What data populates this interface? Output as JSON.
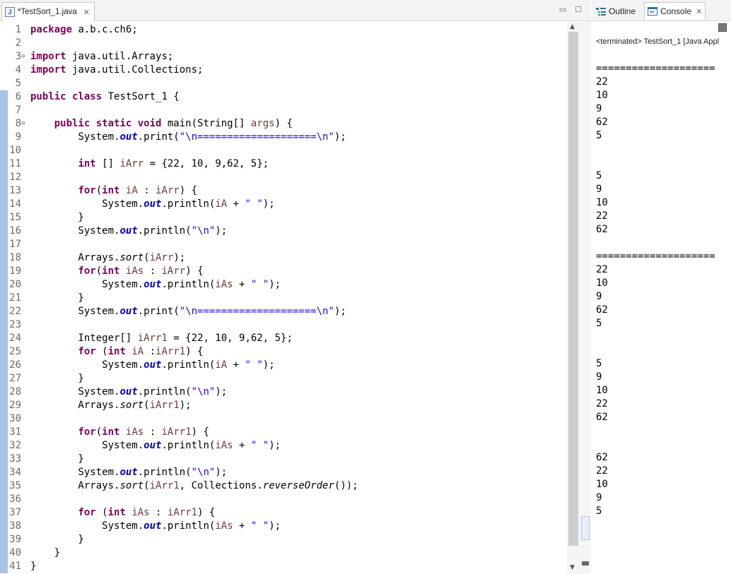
{
  "editor": {
    "tab_label": "*TestSort_1.java",
    "tab_icon": "J",
    "minimize_glyph": "▭",
    "maximize_glyph": "☐",
    "close_glyph": "✕"
  },
  "views": {
    "outline_label": "Outline",
    "console_label": "Console",
    "close_glyph": "✕",
    "status": "<terminated> TestSort_1 [Java Appl",
    "output": [
      "====================",
      "22",
      "10",
      "9",
      "62",
      "5",
      "",
      "",
      "5",
      "9",
      "10",
      "22",
      "62",
      "",
      "====================",
      "22",
      "10",
      "9",
      "62",
      "5",
      "",
      "",
      "5",
      "9",
      "10",
      "22",
      "62",
      "",
      "",
      "62",
      "22",
      "10",
      "9",
      "5"
    ]
  },
  "code": [
    {
      "n": "1",
      "t": [
        [
          "kw",
          "package"
        ],
        [
          "",
          "a.b.c.ch6;"
        ]
      ]
    },
    {
      "n": "2",
      "t": []
    },
    {
      "n": "3",
      "fold": "⊖",
      "t": [
        [
          "kw",
          "import"
        ],
        [
          "",
          " java.util.Arrays;"
        ]
      ]
    },
    {
      "n": "4",
      "t": [
        [
          "kw",
          "import"
        ],
        [
          "",
          " java.util.Collections;"
        ]
      ]
    },
    {
      "n": "5",
      "t": []
    },
    {
      "n": "6",
      "t": [
        [
          "kw",
          "public class"
        ],
        [
          "",
          " TestSort_1 {"
        ]
      ]
    },
    {
      "n": "7",
      "t": []
    },
    {
      "n": "8",
      "fold": "⊖",
      "t": [
        [
          "",
          "    "
        ],
        [
          "kw",
          "public static void"
        ],
        [
          "",
          " main(String[] "
        ],
        [
          "var",
          "args"
        ],
        [
          "",
          ") {"
        ]
      ]
    },
    {
      "n": "9",
      "t": [
        [
          "",
          "        System."
        ],
        [
          "fld",
          "out"
        ],
        [
          "",
          ".print("
        ],
        [
          "str",
          "\"\\n====================\\n\""
        ],
        [
          "",
          ");"
        ]
      ]
    },
    {
      "n": "10",
      "t": []
    },
    {
      "n": "11",
      "t": [
        [
          "",
          "        "
        ],
        [
          "kw",
          "int"
        ],
        [
          "",
          " [] "
        ],
        [
          "var",
          "iArr"
        ],
        [
          "",
          " = {22, 10, 9,62, 5};"
        ]
      ]
    },
    {
      "n": "12",
      "t": []
    },
    {
      "n": "13",
      "t": [
        [
          "",
          "        "
        ],
        [
          "kw",
          "for"
        ],
        [
          "",
          "("
        ],
        [
          "kw",
          "int"
        ],
        [
          "",
          " "
        ],
        [
          "var",
          "iA"
        ],
        [
          "",
          " : "
        ],
        [
          "var",
          "iArr"
        ],
        [
          "",
          ") {"
        ]
      ]
    },
    {
      "n": "14",
      "t": [
        [
          "",
          "            System."
        ],
        [
          "fld",
          "out"
        ],
        [
          "",
          ".println("
        ],
        [
          "var",
          "iA"
        ],
        [
          "",
          " + "
        ],
        [
          "str",
          "\" \""
        ],
        [
          "",
          ");"
        ]
      ]
    },
    {
      "n": "15",
      "t": [
        [
          "",
          "        }"
        ]
      ]
    },
    {
      "n": "16",
      "t": [
        [
          "",
          "        System."
        ],
        [
          "fld",
          "out"
        ],
        [
          "",
          ".println("
        ],
        [
          "str",
          "\"\\n\""
        ],
        [
          "",
          ");"
        ]
      ]
    },
    {
      "n": "17",
      "t": []
    },
    {
      "n": "18",
      "t": [
        [
          "",
          "        Arrays."
        ],
        [
          "mt",
          "sort"
        ],
        [
          "",
          "("
        ],
        [
          "var",
          "iArr"
        ],
        [
          "",
          ");"
        ]
      ]
    },
    {
      "n": "19",
      "t": [
        [
          "",
          "        "
        ],
        [
          "kw",
          "for"
        ],
        [
          "",
          "("
        ],
        [
          "kw",
          "int"
        ],
        [
          "",
          " "
        ],
        [
          "var",
          "iAs"
        ],
        [
          "",
          " : "
        ],
        [
          "var",
          "iArr"
        ],
        [
          "",
          ") {"
        ]
      ]
    },
    {
      "n": "20",
      "t": [
        [
          "",
          "            System."
        ],
        [
          "fld",
          "out"
        ],
        [
          "",
          ".println("
        ],
        [
          "var",
          "iAs"
        ],
        [
          "",
          " + "
        ],
        [
          "str",
          "\" \""
        ],
        [
          "",
          ");"
        ]
      ]
    },
    {
      "n": "21",
      "t": [
        [
          "",
          "        }"
        ]
      ]
    },
    {
      "n": "22",
      "t": [
        [
          "",
          "        System."
        ],
        [
          "fld",
          "out"
        ],
        [
          "",
          ".print("
        ],
        [
          "str",
          "\"\\n====================\\n\""
        ],
        [
          "",
          ");"
        ]
      ]
    },
    {
      "n": "23",
      "t": []
    },
    {
      "n": "24",
      "t": [
        [
          "",
          "        Integer[] "
        ],
        [
          "var",
          "iArr1"
        ],
        [
          "",
          " = {22, 10, 9,62, 5};"
        ]
      ]
    },
    {
      "n": "25",
      "t": [
        [
          "",
          "        "
        ],
        [
          "kw",
          "for"
        ],
        [
          "",
          " ("
        ],
        [
          "kw",
          "int"
        ],
        [
          "",
          " "
        ],
        [
          "var",
          "iA"
        ],
        [
          "",
          " :"
        ],
        [
          "var",
          "iArr1"
        ],
        [
          "",
          ") {"
        ]
      ]
    },
    {
      "n": "26",
      "t": [
        [
          "",
          "            System."
        ],
        [
          "fld",
          "out"
        ],
        [
          "",
          ".println("
        ],
        [
          "var",
          "iA"
        ],
        [
          "",
          " + "
        ],
        [
          "str",
          "\" \""
        ],
        [
          "",
          ");"
        ]
      ]
    },
    {
      "n": "27",
      "t": [
        [
          "",
          "        }"
        ]
      ]
    },
    {
      "n": "28",
      "t": [
        [
          "",
          "        System."
        ],
        [
          "fld",
          "out"
        ],
        [
          "",
          ".println("
        ],
        [
          "str",
          "\"\\n\""
        ],
        [
          "",
          ");"
        ]
      ]
    },
    {
      "n": "29",
      "t": [
        [
          "",
          "        Arrays."
        ],
        [
          "mt",
          "sort"
        ],
        [
          "",
          "("
        ],
        [
          "var",
          "iArr1"
        ],
        [
          "",
          ");"
        ]
      ]
    },
    {
      "n": "30",
      "t": []
    },
    {
      "n": "31",
      "t": [
        [
          "",
          "        "
        ],
        [
          "kw",
          "for"
        ],
        [
          "",
          "("
        ],
        [
          "kw",
          "int"
        ],
        [
          "",
          " "
        ],
        [
          "var",
          "iAs"
        ],
        [
          "",
          " : "
        ],
        [
          "var",
          "iArr1"
        ],
        [
          "",
          ") {"
        ]
      ]
    },
    {
      "n": "32",
      "t": [
        [
          "",
          "            System."
        ],
        [
          "fld",
          "out"
        ],
        [
          "",
          ".println("
        ],
        [
          "var",
          "iAs"
        ],
        [
          "",
          " + "
        ],
        [
          "str",
          "\" \""
        ],
        [
          "",
          ");"
        ]
      ]
    },
    {
      "n": "33",
      "t": [
        [
          "",
          "        }"
        ]
      ]
    },
    {
      "n": "34",
      "t": [
        [
          "",
          "        System."
        ],
        [
          "fld",
          "out"
        ],
        [
          "",
          ".println("
        ],
        [
          "str",
          "\"\\n\""
        ],
        [
          "",
          ");"
        ]
      ]
    },
    {
      "n": "35",
      "t": [
        [
          "",
          "        Arrays."
        ],
        [
          "mt",
          "sort"
        ],
        [
          "",
          "("
        ],
        [
          "var",
          "iArr1"
        ],
        [
          "",
          ", Collections."
        ],
        [
          "mt",
          "reverseOrder"
        ],
        [
          "",
          "());"
        ]
      ]
    },
    {
      "n": "36",
      "t": []
    },
    {
      "n": "37",
      "t": [
        [
          "",
          "        "
        ],
        [
          "kw",
          "for"
        ],
        [
          "",
          " ("
        ],
        [
          "kw",
          "int"
        ],
        [
          "",
          " "
        ],
        [
          "var",
          "iAs"
        ],
        [
          "",
          " : "
        ],
        [
          "var",
          "iArr1"
        ],
        [
          "",
          ") {"
        ]
      ]
    },
    {
      "n": "38",
      "t": [
        [
          "",
          "            System."
        ],
        [
          "fld",
          "out"
        ],
        [
          "",
          ".println("
        ],
        [
          "var",
          "iAs"
        ],
        [
          "",
          " + "
        ],
        [
          "str",
          "\" \""
        ],
        [
          "",
          ");"
        ]
      ]
    },
    {
      "n": "39",
      "t": [
        [
          "",
          "        }"
        ]
      ]
    },
    {
      "n": "40",
      "t": [
        [
          "",
          "    }"
        ]
      ]
    },
    {
      "n": "41",
      "t": [
        [
          "",
          "}"
        ]
      ]
    }
  ],
  "colors": {
    "keyword": "#7f0055",
    "string": "#2a00ff",
    "field": "#0000c0",
    "variable": "#6a3e3e",
    "scope_bar": "#a6c2e6"
  }
}
